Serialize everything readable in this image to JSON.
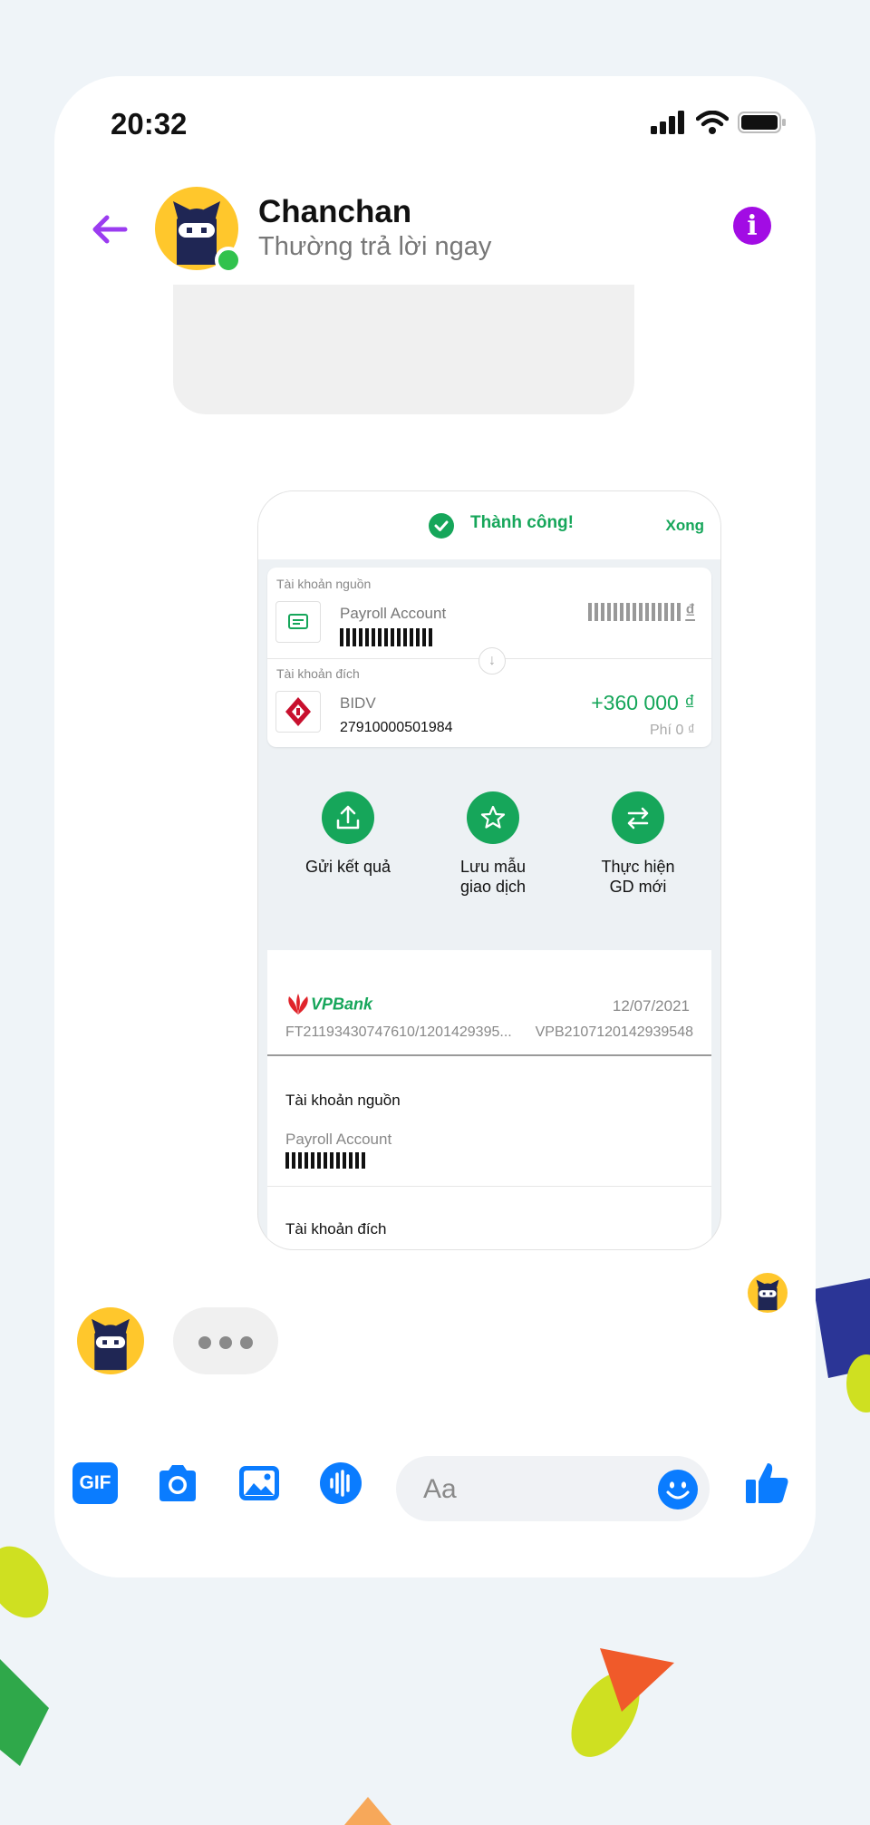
{
  "status_bar": {
    "time": "20:32"
  },
  "header": {
    "name": "Chanchan",
    "status": "Thường trả lời ngay"
  },
  "card": {
    "success_text": "Thành công!",
    "done_label": "Xong",
    "source": {
      "label": "Tài khoản nguồn",
      "name": "Payroll Account",
      "currency": "₫"
    },
    "dest": {
      "label": "Tài khoản đích",
      "bank": "BIDV",
      "number": "27910000501984",
      "amount": "+360 000 ₫",
      "fee": "Phí 0 ₫"
    },
    "actions": [
      {
        "label_line1": "Gửi kết quả",
        "label_line2": "",
        "icon": "upload-icon"
      },
      {
        "label_line1": "Lưu mẫu",
        "label_line2": "giao dịch",
        "icon": "star-icon"
      },
      {
        "label_line1": "Thực hiện",
        "label_line2": "GD mới",
        "icon": "transfer-icon"
      }
    ],
    "receipt": {
      "brand": "VPBank",
      "date": "12/07/2021",
      "ref1": "FT21193430747610/1201429395...",
      "ref2": "VPB2107120142939548",
      "source_label": "Tài khoản nguồn",
      "source_name": "Payroll Account",
      "dest_label": "Tài khoản đích"
    }
  },
  "composer": {
    "placeholder": "Aa",
    "gif_label": "GIF"
  },
  "colors": {
    "accent_green": "#16a65a",
    "messenger_blue": "#0a7cff",
    "back_purple": "#9b3cf0",
    "info_purple": "#a20ce4"
  }
}
